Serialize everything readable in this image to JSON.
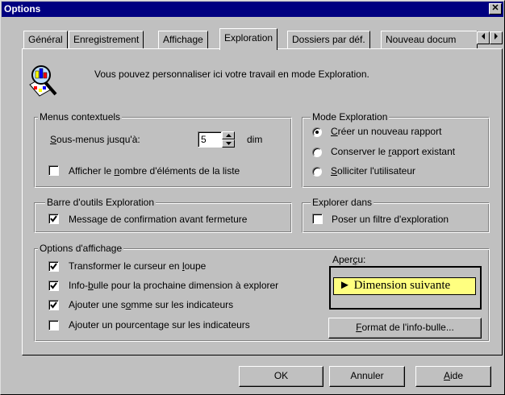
{
  "window": {
    "title": "Options",
    "close_glyph": "✕"
  },
  "tabs": [
    {
      "label": "Général",
      "active": false
    },
    {
      "label": "Enregistrement",
      "active": false
    },
    {
      "label": "Affichage",
      "active": false
    },
    {
      "label": "Exploration",
      "active": true
    },
    {
      "label": "Dossiers par déf.",
      "active": false
    },
    {
      "label": "Nouveau docum",
      "active": false
    }
  ],
  "tab_scroll": {
    "left_icon": "arrow-left-icon",
    "right_icon": "arrow-right-icon"
  },
  "intro": {
    "icon": "magnifier-report-icon",
    "text": "Vous pouvez personnaliser ici votre travail en mode Exploration."
  },
  "menus_contextuels": {
    "title": "Menus contextuels",
    "submenu_label_pre": "",
    "submenu_label_mnemonic": "S",
    "submenu_label_post": "ous-menus jusqu'à:",
    "submenu_value": "5",
    "submenu_unit": "dim",
    "show_count": {
      "pre": "Afficher le ",
      "mnemonic": "n",
      "post": "ombre d'éléments de la liste",
      "checked": false
    }
  },
  "mode_exploration": {
    "title": "Mode Exploration",
    "options": [
      {
        "pre": "",
        "mnemonic": "C",
        "post": "réer un nouveau rapport",
        "selected": true
      },
      {
        "pre": "Conserver le ",
        "mnemonic": "r",
        "post": "apport existant",
        "selected": false
      },
      {
        "pre": "",
        "mnemonic": "S",
        "post": "olliciter l'utilisateur",
        "selected": false
      }
    ]
  },
  "barre_outils": {
    "title": "Barre d'outils Exploration",
    "confirm": {
      "label": "Message de confirmation avant fermeture",
      "checked": true
    }
  },
  "explorer_dans": {
    "title": "Explorer dans",
    "filter": {
      "label": "Poser un filtre d'exploration",
      "checked": false
    }
  },
  "options_affichage": {
    "title": "Options d'affichage",
    "items": [
      {
        "pre": "Transformer le curseur en ",
        "mnemonic": "l",
        "post": "oupe",
        "checked": true
      },
      {
        "pre": "Info-",
        "mnemonic": "b",
        "post": "ulle pour la prochaine dimension à explorer",
        "checked": true
      },
      {
        "pre": "Ajouter une s",
        "mnemonic": "o",
        "post": "mme sur les indicateurs",
        "checked": true
      },
      {
        "pre": "Ajouter un pourcentage sur les indicateurs",
        "mnemonic": "",
        "post": "",
        "checked": false
      }
    ],
    "preview_label_pre": "Aper",
    "preview_label_mnemonic": "ç",
    "preview_label_post": "u:",
    "preview_tooltip": "► Dimension suivante",
    "format_button": {
      "pre": "",
      "mnemonic": "F",
      "post": "ormat de l'info-bulle..."
    }
  },
  "buttons": {
    "ok": "OK",
    "cancel": "Annuler",
    "help_mnemonic": "A",
    "help_post": "ide"
  }
}
